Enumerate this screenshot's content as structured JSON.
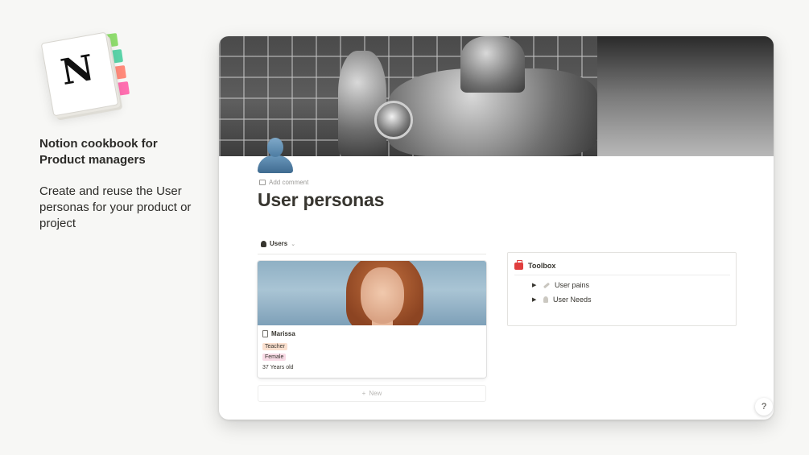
{
  "promo": {
    "title": "Notion cookbook for Product managers",
    "description": "Create and reuse the User personas for your product or project",
    "logo_letter": "N",
    "logo_tab_colors": [
      "#8fdc6e",
      "#5bd3a8",
      "#ff8a7a",
      "#ff6fb0"
    ]
  },
  "page": {
    "icon": "bust-silhouette-icon",
    "add_comment": "Add comment",
    "title": "User personas"
  },
  "gallery": {
    "view_label": "Users",
    "cards": [
      {
        "title": "Marissa",
        "tags": [
          {
            "label": "Teacher",
            "color": "#fae0cf"
          },
          {
            "label": "Female",
            "color": "#f8dbe6"
          }
        ],
        "age": "37 Years old"
      }
    ],
    "new_label": "New"
  },
  "toolbox": {
    "title": "Toolbox",
    "icon": "toolbox-icon",
    "items": [
      {
        "label": "User pains",
        "icon": "pen-icon"
      },
      {
        "label": "User Needs",
        "icon": "pin-icon"
      }
    ]
  },
  "help": {
    "label": "?"
  },
  "colors": {
    "background": "#f7f7f5",
    "text": "#37352f",
    "muted": "#9b9a97",
    "toolbox_red": "#e03e3e"
  }
}
